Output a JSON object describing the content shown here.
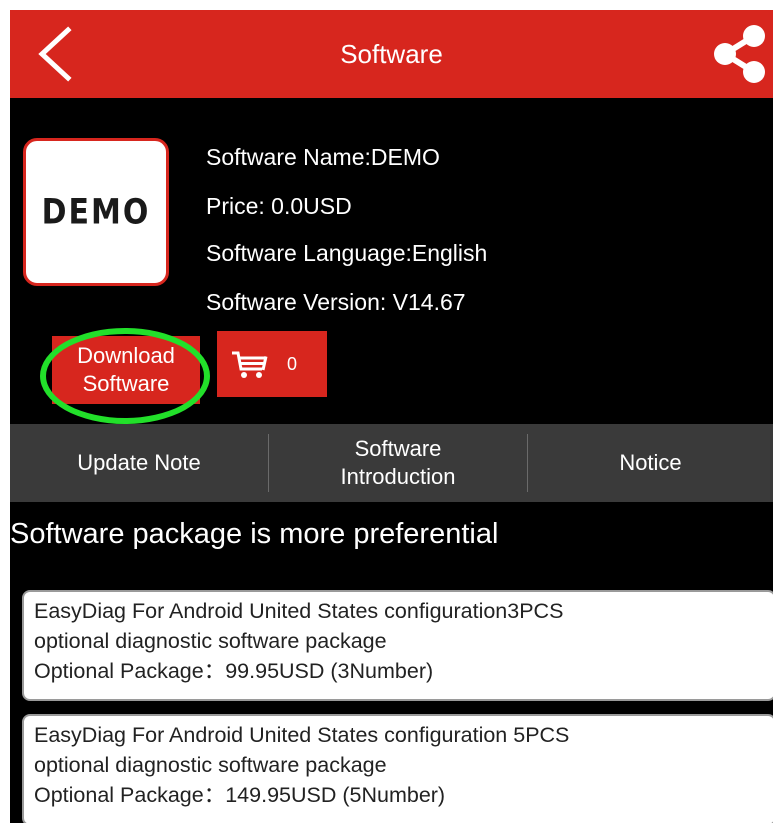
{
  "appbar": {
    "title": "Software"
  },
  "software": {
    "logo_text": "DEMO",
    "name_line": "Software Name:DEMO",
    "price_line": "Price: 0.0USD",
    "language_line": "Software Language:English",
    "version_line": "Software Version: V14.67"
  },
  "actions": {
    "download_line1": "Download",
    "download_line2": "Software",
    "cart_count": "0"
  },
  "tabs": [
    {
      "label": "Update Note"
    },
    {
      "label_line1": "Software",
      "label_line2": "Introduction"
    },
    {
      "label": "Notice"
    }
  ],
  "packages": {
    "heading": "Software package is more preferential",
    "items": [
      {
        "name_line1": "EasyDiag For Android United States configuration3PCS",
        "name_line2": "optional diagnostic software package",
        "price": "Optional Package：99.95USD  (3Number)"
      },
      {
        "name_line1": "EasyDiag For Android United States configuration 5PCS",
        "name_line2": "optional diagnostic software package",
        "price": "Optional Package：149.95USD  (5Number)"
      }
    ]
  },
  "colors": {
    "accent": "#d7261e",
    "background": "#000000",
    "tab_bar": "#3a3a3a",
    "highlight": "#22e02a"
  },
  "icons": {
    "back": "chevron-left-icon",
    "share": "share-icon",
    "cart": "cart-icon"
  }
}
